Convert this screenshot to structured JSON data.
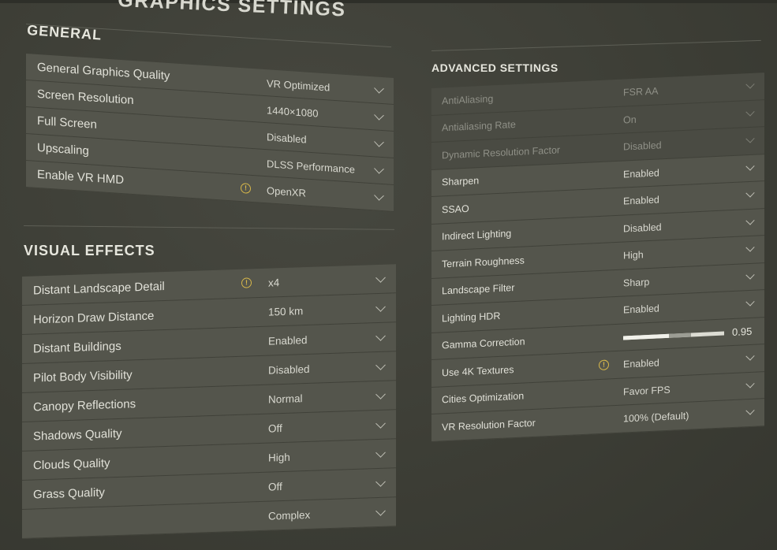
{
  "title": "GRAPHICS SETTINGS",
  "general": {
    "heading": "GENERAL",
    "rows": [
      {
        "label": "General Graphics Quality",
        "value": "VR Optimized"
      },
      {
        "label": "Screen Resolution",
        "value": "1440×1080"
      },
      {
        "label": "Full Screen",
        "value": "Disabled"
      },
      {
        "label": "Upscaling",
        "value": "DLSS Performance"
      },
      {
        "label": "Enable VR HMD",
        "value": "OpenXR",
        "warning": true
      }
    ]
  },
  "visual_effects": {
    "heading": "VISUAL EFFECTS",
    "rows": [
      {
        "label": "Distant Landscape Detail",
        "value": "x4",
        "warning": true
      },
      {
        "label": "Horizon Draw Distance",
        "value": "150 km"
      },
      {
        "label": "Distant Buildings",
        "value": "Enabled"
      },
      {
        "label": "Pilot Body Visibility",
        "value": "Disabled"
      },
      {
        "label": "Canopy Reflections",
        "value": "Normal"
      },
      {
        "label": "Shadows Quality",
        "value": "Off"
      },
      {
        "label": "Clouds Quality",
        "value": "High"
      },
      {
        "label": "Grass Quality",
        "value": "Off"
      },
      {
        "label": "",
        "value": "Complex"
      }
    ]
  },
  "advanced": {
    "heading": "ADVANCED SETTINGS",
    "rows": [
      {
        "label": "AntiAliasing",
        "value": "FSR AA",
        "disabled": true
      },
      {
        "label": "Antialiasing Rate",
        "value": "On",
        "disabled": true
      },
      {
        "label": "Dynamic Resolution Factor",
        "value": "Disabled",
        "disabled": true
      },
      {
        "label": "Sharpen",
        "value": "Enabled"
      },
      {
        "label": "SSAO",
        "value": "Enabled"
      },
      {
        "label": "Indirect Lighting",
        "value": "Disabled"
      },
      {
        "label": "Terrain Roughness",
        "value": "High"
      },
      {
        "label": "Landscape Filter",
        "value": "Sharp"
      },
      {
        "label": "Lighting HDR",
        "value": "Enabled"
      },
      {
        "label": "Gamma Correction",
        "slider": 0.95,
        "slider_min": 0.5,
        "slider_max": 1.5,
        "value": "0.95"
      },
      {
        "label": "Use 4K Textures",
        "value": "Enabled",
        "warning": true
      },
      {
        "label": "Cities Optimization",
        "value": "Favor FPS"
      },
      {
        "label": "VR Resolution Factor",
        "value": "100% (Default)"
      }
    ]
  },
  "icons": {
    "warning": "warning-circle-icon",
    "dropdown": "chevron-down-icon"
  },
  "colors": {
    "background": "#3e3f37",
    "row": "#54554c",
    "warning": "#d8b84a"
  }
}
